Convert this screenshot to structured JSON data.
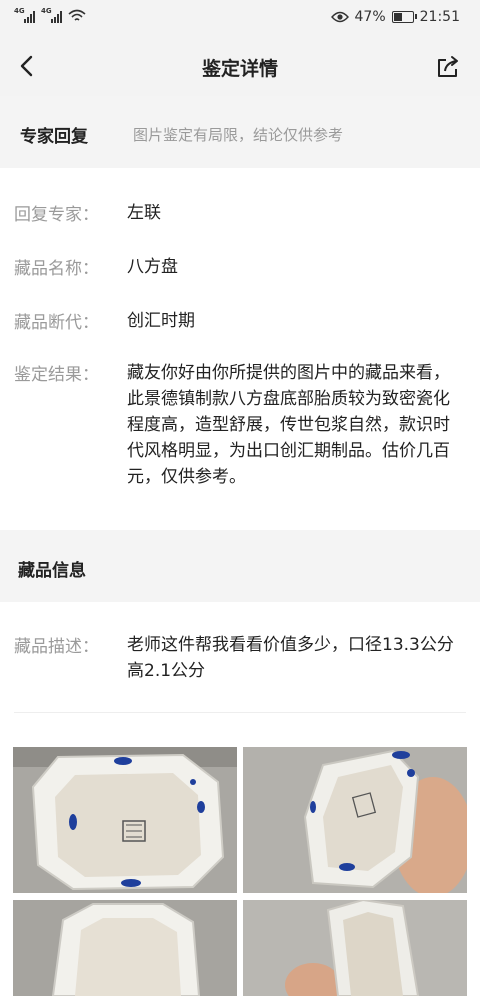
{
  "status_bar": {
    "net1": "4G",
    "net2": "4G",
    "battery_percent": "47%",
    "time": "21:51",
    "battery_level": 0.47
  },
  "navbar": {
    "title": "鉴定详情"
  },
  "expert_section": {
    "heading": "专家回复",
    "note": "图片鉴定有局限，结论仅供参考",
    "rows": [
      {
        "label": "回复专家：",
        "value": "左联"
      },
      {
        "label": "藏品名称：",
        "value": "八方盘"
      },
      {
        "label": "藏品断代：",
        "value": "创汇时期"
      },
      {
        "label": "鉴定结果：",
        "value": "藏友你好由你所提供的图片中的藏品来看，此景德镇制款八方盘底部胎质较为致密瓷化程度高，造型舒展，传世包浆自然，款识时代风格明显，为出口创汇期制品。估价几百元，仅供参考。"
      }
    ]
  },
  "item_section": {
    "heading": "藏品信息",
    "description_label": "藏品描述：",
    "description_value": "老师这件帮我看看价值多少，口径13.3公分 高2.1公分"
  },
  "icons": {
    "back": "chevron-left-icon",
    "share": "share-icon",
    "eye": "eye-icon",
    "wifi": "wifi-icon",
    "battery": "battery-icon"
  },
  "colors": {
    "section_bg": "#f4f4f4",
    "label_gray": "#9a9a9a",
    "text": "#222222",
    "porcelain_blue": "#1f3f9c"
  }
}
